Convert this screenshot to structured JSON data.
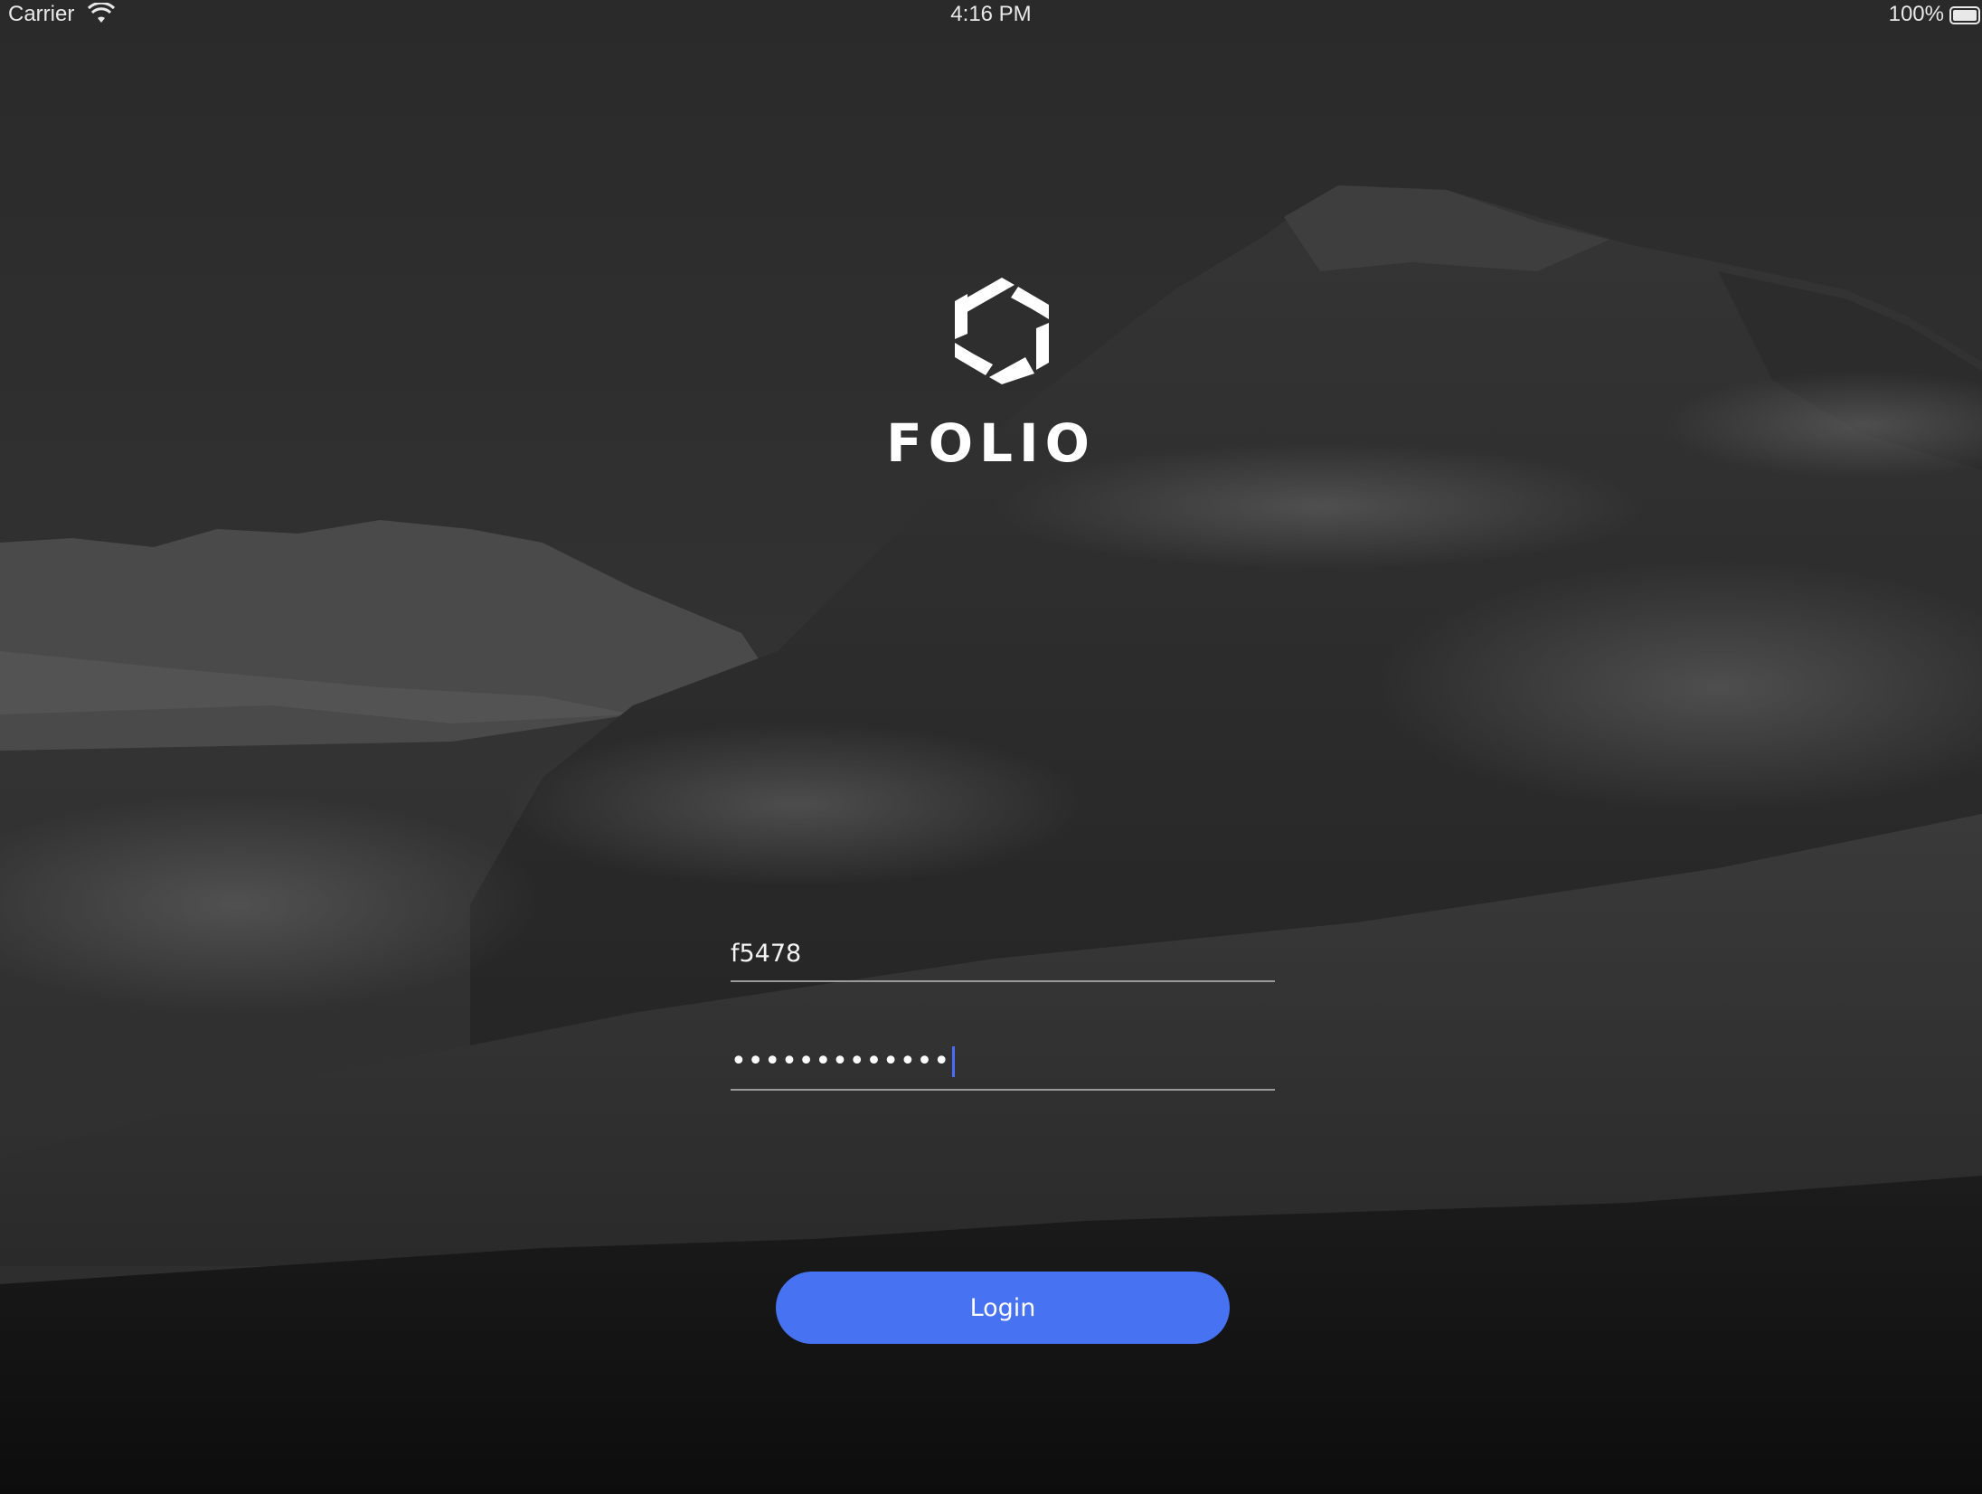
{
  "status_bar": {
    "carrier": "Carrier",
    "time": "4:16 PM",
    "battery": "100%",
    "icons": [
      "wifi-icon",
      "battery-icon"
    ]
  },
  "brand": {
    "logo_icon": "folio-hexagon-logo-icon",
    "name": "FOLIO"
  },
  "login_form": {
    "username": {
      "value": "f5478"
    },
    "password": {
      "masked_value": "•••••••••••••"
    },
    "login_label": "Login"
  },
  "colors": {
    "accent": "#4772f2",
    "cursor": "#4a6cf7",
    "text": "#ffffff",
    "underline": "#9a9a9a"
  }
}
